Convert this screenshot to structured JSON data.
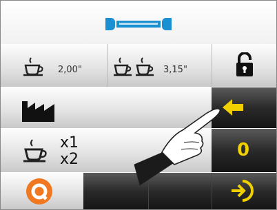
{
  "header": {
    "icon": "wrench-icon"
  },
  "coffee_row": {
    "single": {
      "icon": "coffee-cup-icon",
      "value": "2,00\""
    },
    "double": {
      "icon": "double-coffee-cup-icon",
      "value": "3,15\""
    },
    "lock": {
      "icon": "unlock-icon"
    }
  },
  "factory_row": {
    "icon": "factory-icon",
    "nav_icon": "arrow-left-icon"
  },
  "counter_row": {
    "icon": "coffee-cup-icon",
    "x1_label": "x1",
    "x2_label": "x2",
    "reset_value": "0"
  },
  "bottom_row": {
    "logo_icon": "brand-logo-icon",
    "exit_icon": "exit-icon"
  },
  "colors": {
    "accent_blue": "#1a8fd1",
    "accent_yellow": "#f0d000",
    "logo_orange": "#f07820"
  }
}
